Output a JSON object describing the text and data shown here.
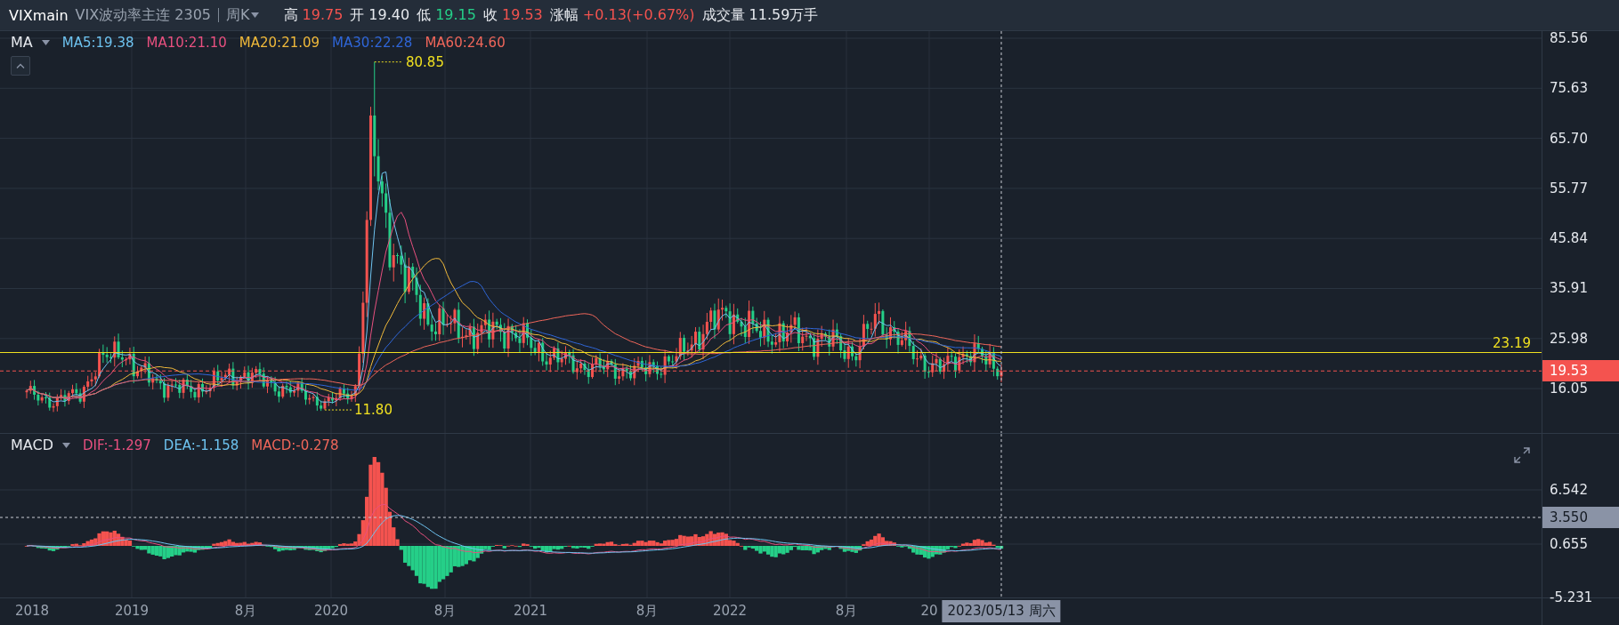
{
  "header": {
    "symbol": "VIXmain",
    "name": "VIX波动率主连 2305",
    "period": "周K",
    "quote": [
      {
        "label": "高",
        "value": "19.75",
        "color": "#f4534f"
      },
      {
        "label": "开",
        "value": "19.40",
        "color": "#e6e9ee"
      },
      {
        "label": "低",
        "value": "19.15",
        "color": "#25cf88"
      },
      {
        "label": "收",
        "value": "19.53",
        "color": "#f4534f"
      },
      {
        "label": "涨幅",
        "value": "+0.13(+0.67%)",
        "color": "#f4534f"
      },
      {
        "label": "成交量",
        "value": "11.59万手",
        "color": "#e6e9ee"
      }
    ]
  },
  "main_panel": {
    "indicator": "MA",
    "legend": [
      {
        "text": "MA5:19.38",
        "color": "#6ec3f0"
      },
      {
        "text": "MA10:21.10",
        "color": "#e8507f"
      },
      {
        "text": "MA20:21.09",
        "color": "#f0b93a"
      },
      {
        "text": "MA30:22.28",
        "color": "#2f66d8"
      },
      {
        "text": "MA60:24.60",
        "color": "#f0665a"
      }
    ],
    "high_marker": "80.85",
    "low_marker": "11.80",
    "level_line": "23.19",
    "last_price": "19.53",
    "axis": [
      "85.56",
      "75.63",
      "65.70",
      "55.77",
      "45.84",
      "35.91",
      "25.98",
      "16.05"
    ]
  },
  "macd_panel": {
    "indicator": "MACD",
    "legend": [
      {
        "text": "DIF:-1.297",
        "color": "#e8507f"
      },
      {
        "text": "DEA:-1.158",
        "color": "#6ec3f0"
      },
      {
        "text": "MACD:-0.278",
        "color": "#f0665a"
      }
    ],
    "axis": [
      "6.542",
      "0.655",
      "-5.231"
    ],
    "crosshair_value": "3.550"
  },
  "time_axis": {
    "labels": [
      "2018",
      "2019",
      "8月",
      "2020",
      "8月",
      "2021",
      "8月",
      "2022",
      "8月",
      "20"
    ],
    "crosshair_date": "2023/05/13 周六"
  }
}
